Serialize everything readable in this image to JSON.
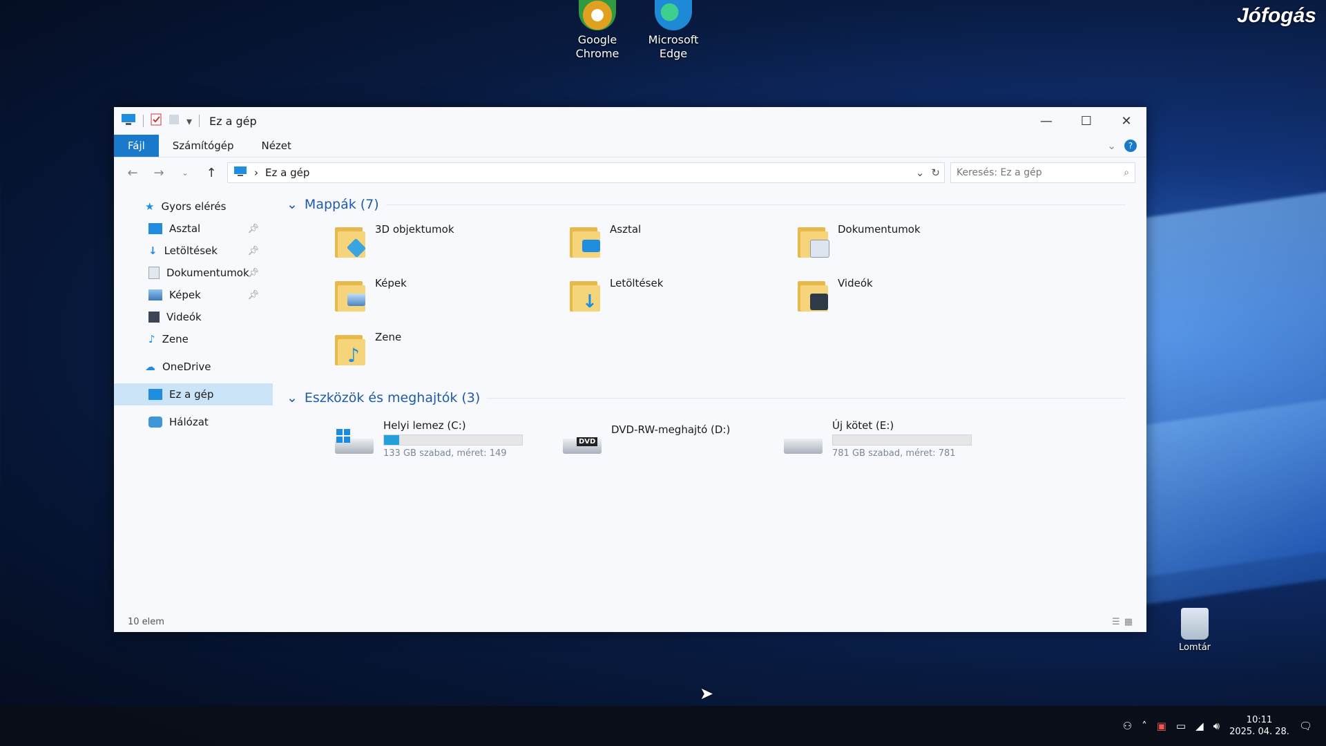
{
  "watermark": "Jófogás",
  "desktop": {
    "icons": [
      {
        "label": "Google\nChrome",
        "icon": "chrome-icon",
        "color": "#e0a020"
      },
      {
        "label": "Microsoft\nEdge",
        "icon": "edge-icon",
        "color": "#1e8ad6"
      }
    ],
    "recycle_bin": "Lomtár"
  },
  "window": {
    "title": "Ez a gép",
    "ribbon_tabs": [
      "Fájl",
      "Számítógép",
      "Nézet"
    ],
    "address": "Ez a gép",
    "search_placeholder": "Keresés: Ez a gép",
    "accent": "#1979ca"
  },
  "sidebar": {
    "quick_access": "Gyors elérés",
    "items": [
      {
        "label": "Asztal",
        "icon": "desktop-icon",
        "pinned": true
      },
      {
        "label": "Letöltések",
        "icon": "download-icon",
        "pinned": true
      },
      {
        "label": "Dokumentumok",
        "icon": "document-icon",
        "pinned": true
      },
      {
        "label": "Képek",
        "icon": "pictures-icon",
        "pinned": true
      },
      {
        "label": "Videók",
        "icon": "video-icon",
        "pinned": false
      },
      {
        "label": "Zene",
        "icon": "music-icon",
        "pinned": false
      }
    ],
    "onedrive": "OneDrive",
    "this_pc": "Ez a gép",
    "network": "Hálózat"
  },
  "folders_group": "Mappák (7)",
  "folders": [
    {
      "label": "3D objektumok",
      "icon": "3d-objects-icon",
      "badge": "#3aa3e0"
    },
    {
      "label": "Asztal",
      "icon": "desktop-folder-icon",
      "badge": "#1f8ee0"
    },
    {
      "label": "Dokumentumok",
      "icon": "documents-folder-icon",
      "badge": "#dde6f0"
    },
    {
      "label": "Képek",
      "icon": "pictures-folder-icon",
      "badge": "#6fa8d8"
    },
    {
      "label": "Letöltések",
      "icon": "downloads-folder-icon",
      "badge": "#1f8ee0"
    },
    {
      "label": "Videók",
      "icon": "videos-folder-icon",
      "badge": "#2e3a48"
    },
    {
      "label": "Zene",
      "icon": "music-folder-icon",
      "badge": "#1f8ee0"
    }
  ],
  "drives_group": "Eszközök és meghajtók (3)",
  "drives": [
    {
      "label": "Helyi lemez (C:)",
      "sub": "133 GB szabad, méret: 149",
      "used_fraction": 0.11,
      "kind": "system"
    },
    {
      "label": "DVD-RW-meghajtó (D:)",
      "sub": "",
      "used_fraction": null,
      "kind": "dvd"
    },
    {
      "label": "Új kötet (E:)",
      "sub": "781 GB szabad, méret: 781",
      "used_fraction": 0.0,
      "kind": "disk"
    }
  ],
  "status": "10 elem",
  "taskbar": {
    "time": "10:11",
    "date": "2025. 04. 28."
  }
}
